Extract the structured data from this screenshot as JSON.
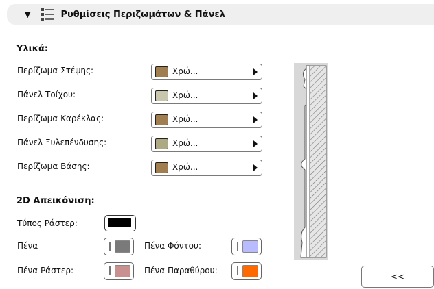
{
  "header": {
    "title": "Ρυθμίσεις Περιζωμάτων & Πάνελ"
  },
  "materials": {
    "title": "Υλικά:",
    "items": [
      {
        "label": "Περίζωμα Στέψης:",
        "value": "Χρώ...",
        "color": "#a07e50"
      },
      {
        "label": "Πάνελ Τοίχου:",
        "value": "Χρώ...",
        "color": "#c8c6ac"
      },
      {
        "label": "Περίζωμα Καρέκλας:",
        "value": "Χρώ...",
        "color": "#a07e50"
      },
      {
        "label": "Πάνελ Ξυλεπένδυσης:",
        "value": "Χρώ...",
        "color": "#aca983"
      },
      {
        "label": "Περίζωμα Βάσης:",
        "value": "Χρώ...",
        "color": "#a07e50"
      }
    ]
  },
  "display2d": {
    "title": "2D Απεικόνιση:",
    "raster_type_label": "Τύπος Ράστερ:",
    "raster_color": "#000000",
    "pen_label": "Πένα",
    "pen_color": "#7a7a7a",
    "bg_pen_label": "Πένα Φόντου:",
    "bg_pen_color": "#b8bcff",
    "raster_pen_label": "Πένα Ράστερ:",
    "raster_pen_color": "#c99090",
    "window_pen_label": "Πένα Παραθύρου:",
    "window_pen_color": "#ff6a00"
  },
  "collapse_button": {
    "label": "<<"
  }
}
